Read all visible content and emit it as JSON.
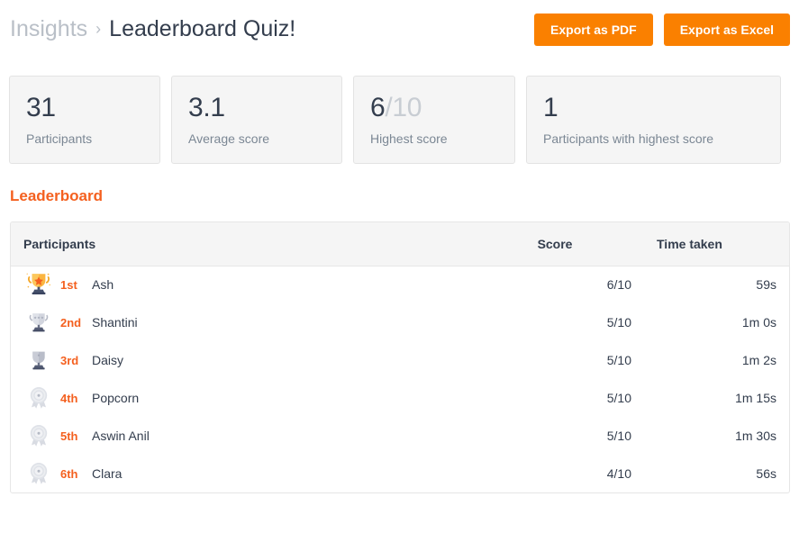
{
  "breadcrumb": {
    "parent": "Insights",
    "separator": "›",
    "current": "Leaderboard Quiz!"
  },
  "toolbar": {
    "export_pdf_label": "Export as PDF",
    "export_excel_label": "Export as Excel"
  },
  "colors": {
    "brand_orange": "#fa8000",
    "heading_orange": "#f4601f",
    "card_bg": "#f5f5f5",
    "text_dark": "#333d4d",
    "text_muted": "#7b8794"
  },
  "stats": [
    {
      "value": "31",
      "value_muted": "",
      "label": "Participants"
    },
    {
      "value": "3.1",
      "value_muted": "",
      "label": "Average score"
    },
    {
      "value": "6",
      "value_muted": "/10",
      "label": "Highest score"
    },
    {
      "value": "1",
      "value_muted": "",
      "label": "Participants with highest score"
    }
  ],
  "section": {
    "title": "Leaderboard"
  },
  "table": {
    "columns": {
      "participants": "Participants",
      "score": "Score",
      "time": "Time taken"
    },
    "rows": [
      {
        "icon": "gold-trophy-icon",
        "rank": "1st",
        "name": "Ash",
        "score": "6/10",
        "time": "59s"
      },
      {
        "icon": "silver-trophy-icon",
        "rank": "2nd",
        "name": "Shantini",
        "score": "5/10",
        "time": "1m 0s"
      },
      {
        "icon": "bronze-trophy-icon",
        "rank": "3rd",
        "name": "Daisy",
        "score": "5/10",
        "time": "1m 2s"
      },
      {
        "icon": "medal-icon",
        "rank": "4th",
        "name": "Popcorn",
        "score": "5/10",
        "time": "1m 15s"
      },
      {
        "icon": "medal-icon",
        "rank": "5th",
        "name": "Aswin Anil",
        "score": "5/10",
        "time": "1m 30s"
      },
      {
        "icon": "medal-icon",
        "rank": "6th",
        "name": "Clara",
        "score": "4/10",
        "time": "56s"
      }
    ]
  }
}
